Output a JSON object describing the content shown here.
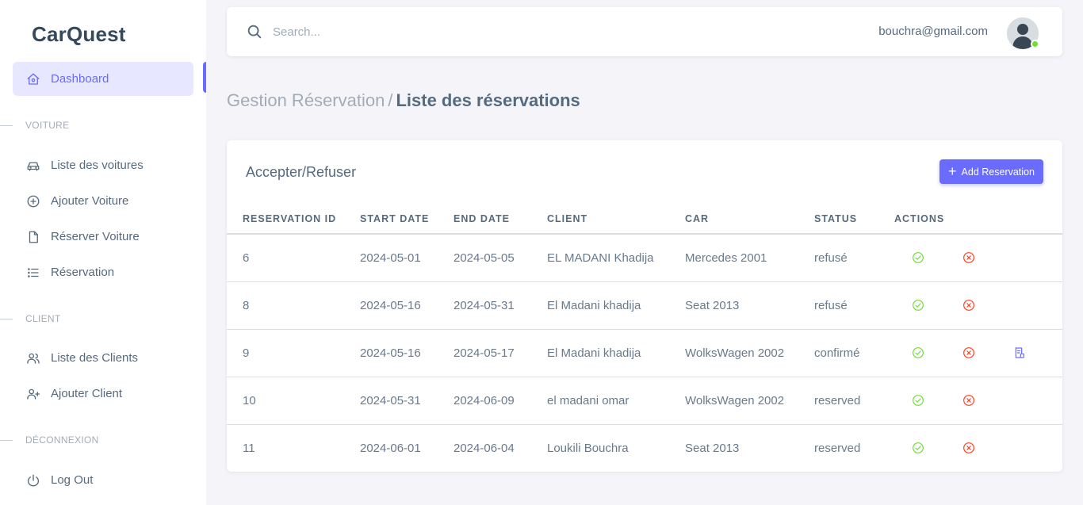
{
  "app": {
    "brand": "CarQuest"
  },
  "sidebar": {
    "items": [
      {
        "label": "Dashboard",
        "icon": "home-icon"
      }
    ],
    "sections": [
      {
        "title": "VOITURE",
        "items": [
          {
            "label": "Liste des voitures",
            "icon": "car-icon"
          },
          {
            "label": "Ajouter Voiture",
            "icon": "plus-circle-icon"
          },
          {
            "label": "Réserver Voiture",
            "icon": "file-icon"
          },
          {
            "label": "Réservation",
            "icon": "list-icon"
          }
        ]
      },
      {
        "title": "CLIENT",
        "items": [
          {
            "label": "Liste des Clients",
            "icon": "users-icon"
          },
          {
            "label": "Ajouter Client",
            "icon": "user-plus-icon"
          }
        ]
      },
      {
        "title": "DÉCONNEXION",
        "items": [
          {
            "label": "Log Out",
            "icon": "power-icon"
          }
        ]
      }
    ]
  },
  "navbar": {
    "search_placeholder": "Search...",
    "user_email": "bouchra@gmail.com"
  },
  "breadcrumb": {
    "parent": "Gestion Réservation",
    "separator": "/",
    "current": "Liste des réservations"
  },
  "card": {
    "title": "Accepter/Refuser",
    "add_button": "Add Reservation"
  },
  "table": {
    "headers": [
      "RESERVATION ID",
      "START DATE",
      "END DATE",
      "CLIENT",
      "CAR",
      "STATUS",
      "ACTIONS"
    ],
    "rows": [
      {
        "id": "6",
        "start": "2024-05-01",
        "end": "2024-05-05",
        "client": "EL MADANI Khadija",
        "car": "Mercedes 2001",
        "status": "refusé",
        "has_doc": false
      },
      {
        "id": "8",
        "start": "2024-05-16",
        "end": "2024-05-31",
        "client": "El Madani khadija",
        "car": "Seat 2013",
        "status": "refusé",
        "has_doc": false
      },
      {
        "id": "9",
        "start": "2024-05-16",
        "end": "2024-05-17",
        "client": "El Madani khadija",
        "car": "WolksWagen 2002",
        "status": "confirmé",
        "has_doc": true
      },
      {
        "id": "10",
        "start": "2024-05-31",
        "end": "2024-06-09",
        "client": "el madani omar",
        "car": "WolksWagen 2002",
        "status": "reserved",
        "has_doc": false
      },
      {
        "id": "11",
        "start": "2024-06-01",
        "end": "2024-06-04",
        "client": "Loukili Bouchra",
        "car": "Seat 2013",
        "status": "reserved",
        "has_doc": false
      }
    ]
  },
  "colors": {
    "accent": "#696cff",
    "accept": "#71dd37",
    "refuse": "#ff3e1d",
    "online": "#71dd37"
  }
}
